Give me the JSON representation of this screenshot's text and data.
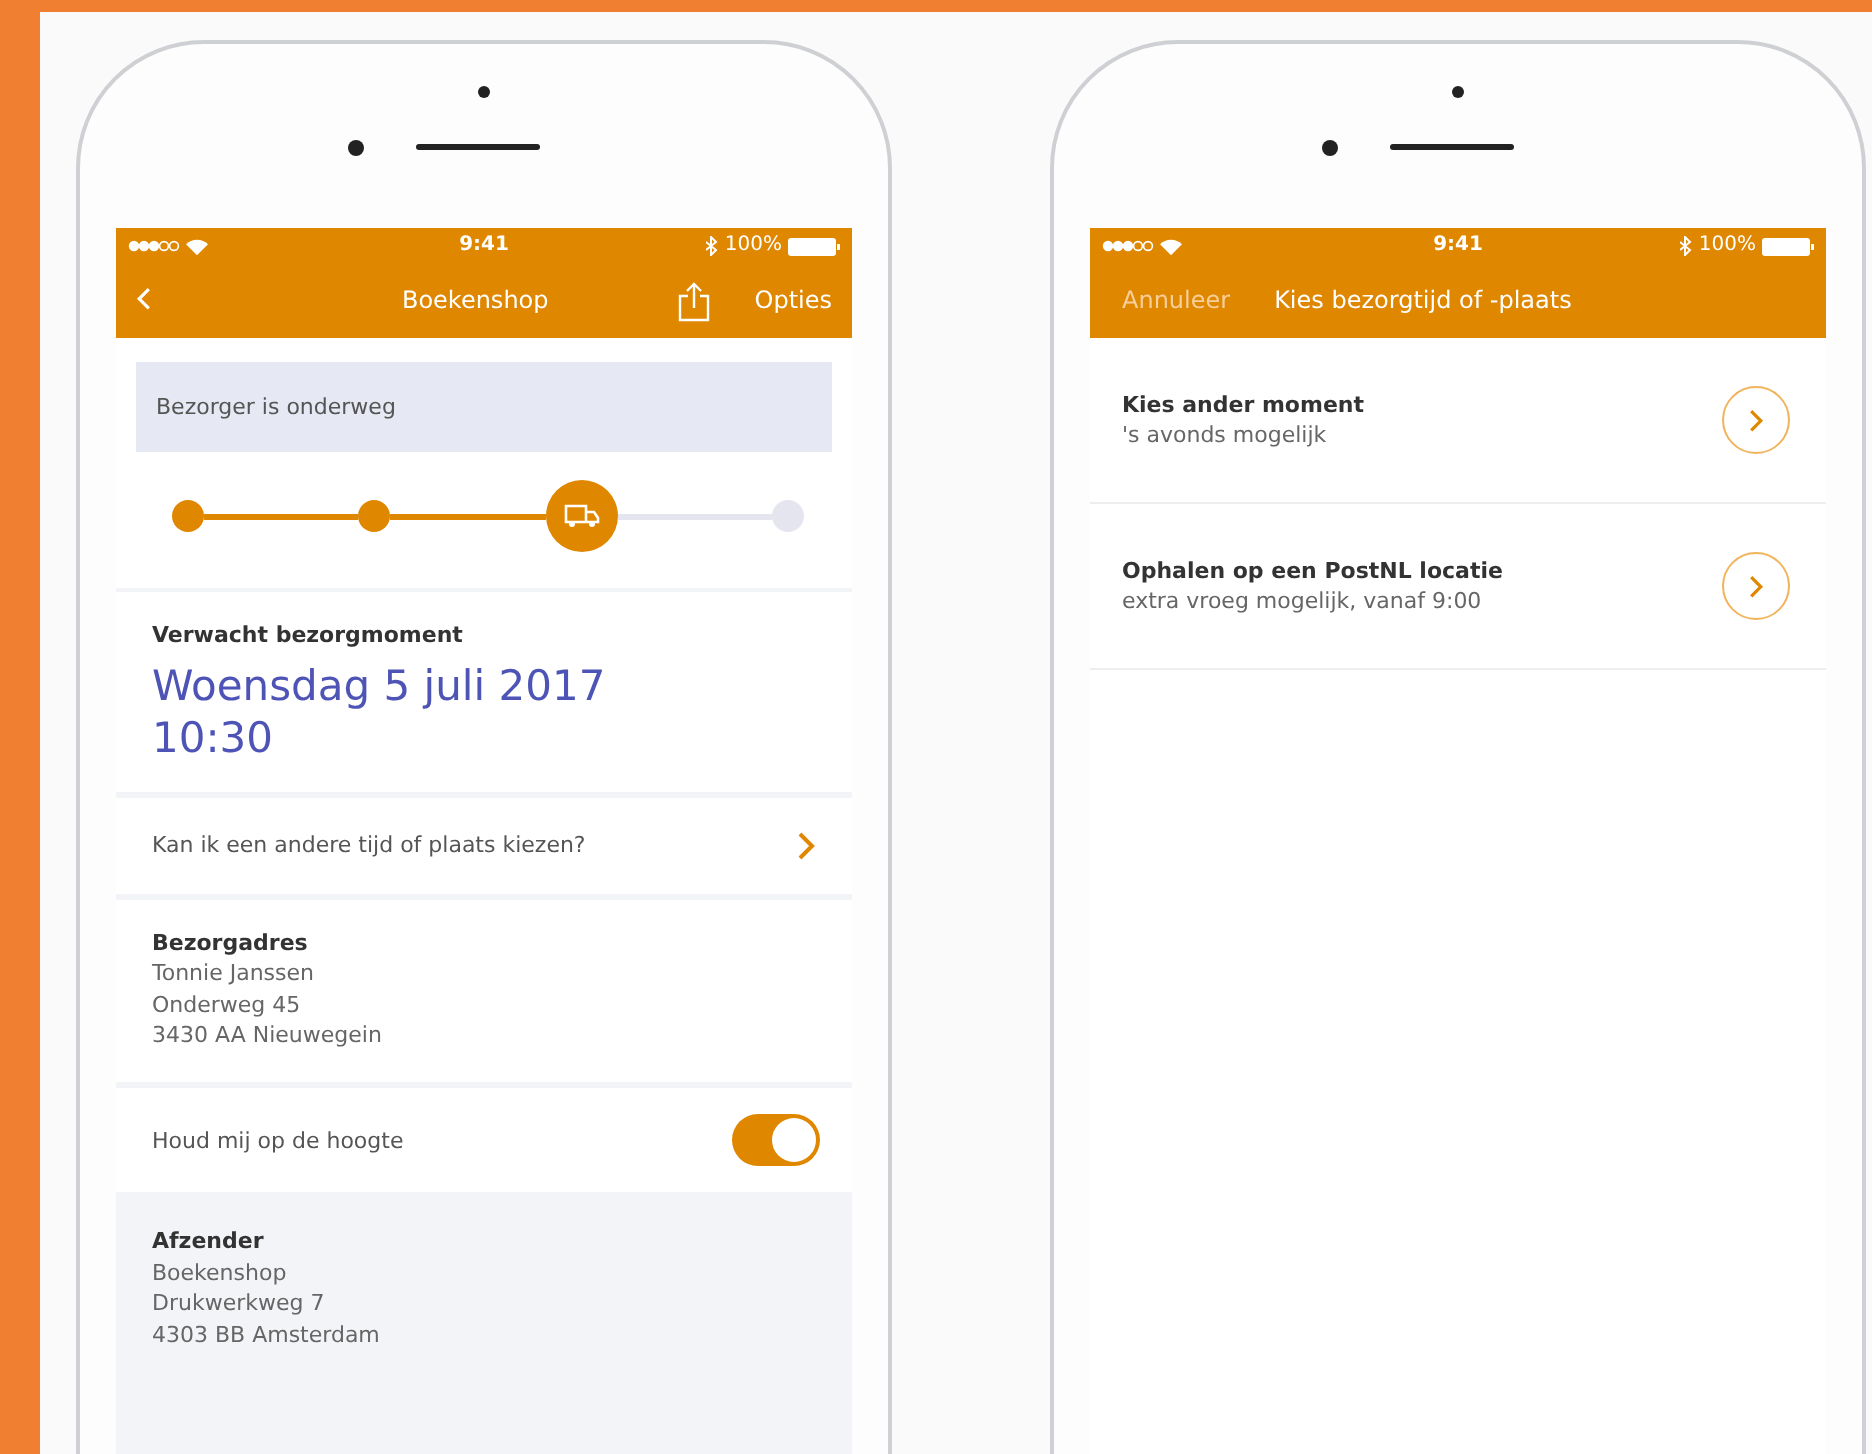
{
  "phones": [
    {
      "kind": "tracking",
      "status_bar": {
        "time": "9:41",
        "battery": "100%"
      },
      "nav": {
        "title": "Boekenshop",
        "action": "Opties"
      },
      "banner": "Bezorger is onderweg",
      "steps": [
        {
          "reached": true,
          "selected": false
        },
        {
          "reached": true,
          "selected": false
        },
        {
          "reached": true,
          "selected": true
        },
        {
          "reached": false,
          "selected": false
        }
      ],
      "expected": {
        "label": "Verwacht bezorgmoment",
        "date": "Woensdag 5 juli 2017",
        "time": "10:30"
      },
      "change_link": "Kan ik een andere tijd of plaats kiezen?",
      "address": {
        "label": "Bezorgadres",
        "lines": [
          "Tonnie Janssen",
          "Onderweg 45",
          "3430 AA Nieuwegein"
        ]
      },
      "notify": {
        "label": "Houd mij op de hoogte",
        "on": true
      },
      "sender": {
        "label": "Afzender",
        "lines": [
          "Boekenshop",
          "Drukwerkweg 7",
          "4303 BB Amsterdam"
        ]
      }
    },
    {
      "kind": "options",
      "status_bar": {
        "time": "9:41",
        "battery": "100%"
      },
      "nav": {
        "cancel": "Annuleer",
        "title": "Kies bezorgtijd of -plaats"
      },
      "options": [
        {
          "title": "Kies ander moment",
          "subtitle": "'s avonds mogelijk"
        },
        {
          "title": "Ophalen op een PostNL locatie",
          "subtitle": "extra vroeg mogelijk, vanaf 9:00"
        }
      ]
    }
  ]
}
